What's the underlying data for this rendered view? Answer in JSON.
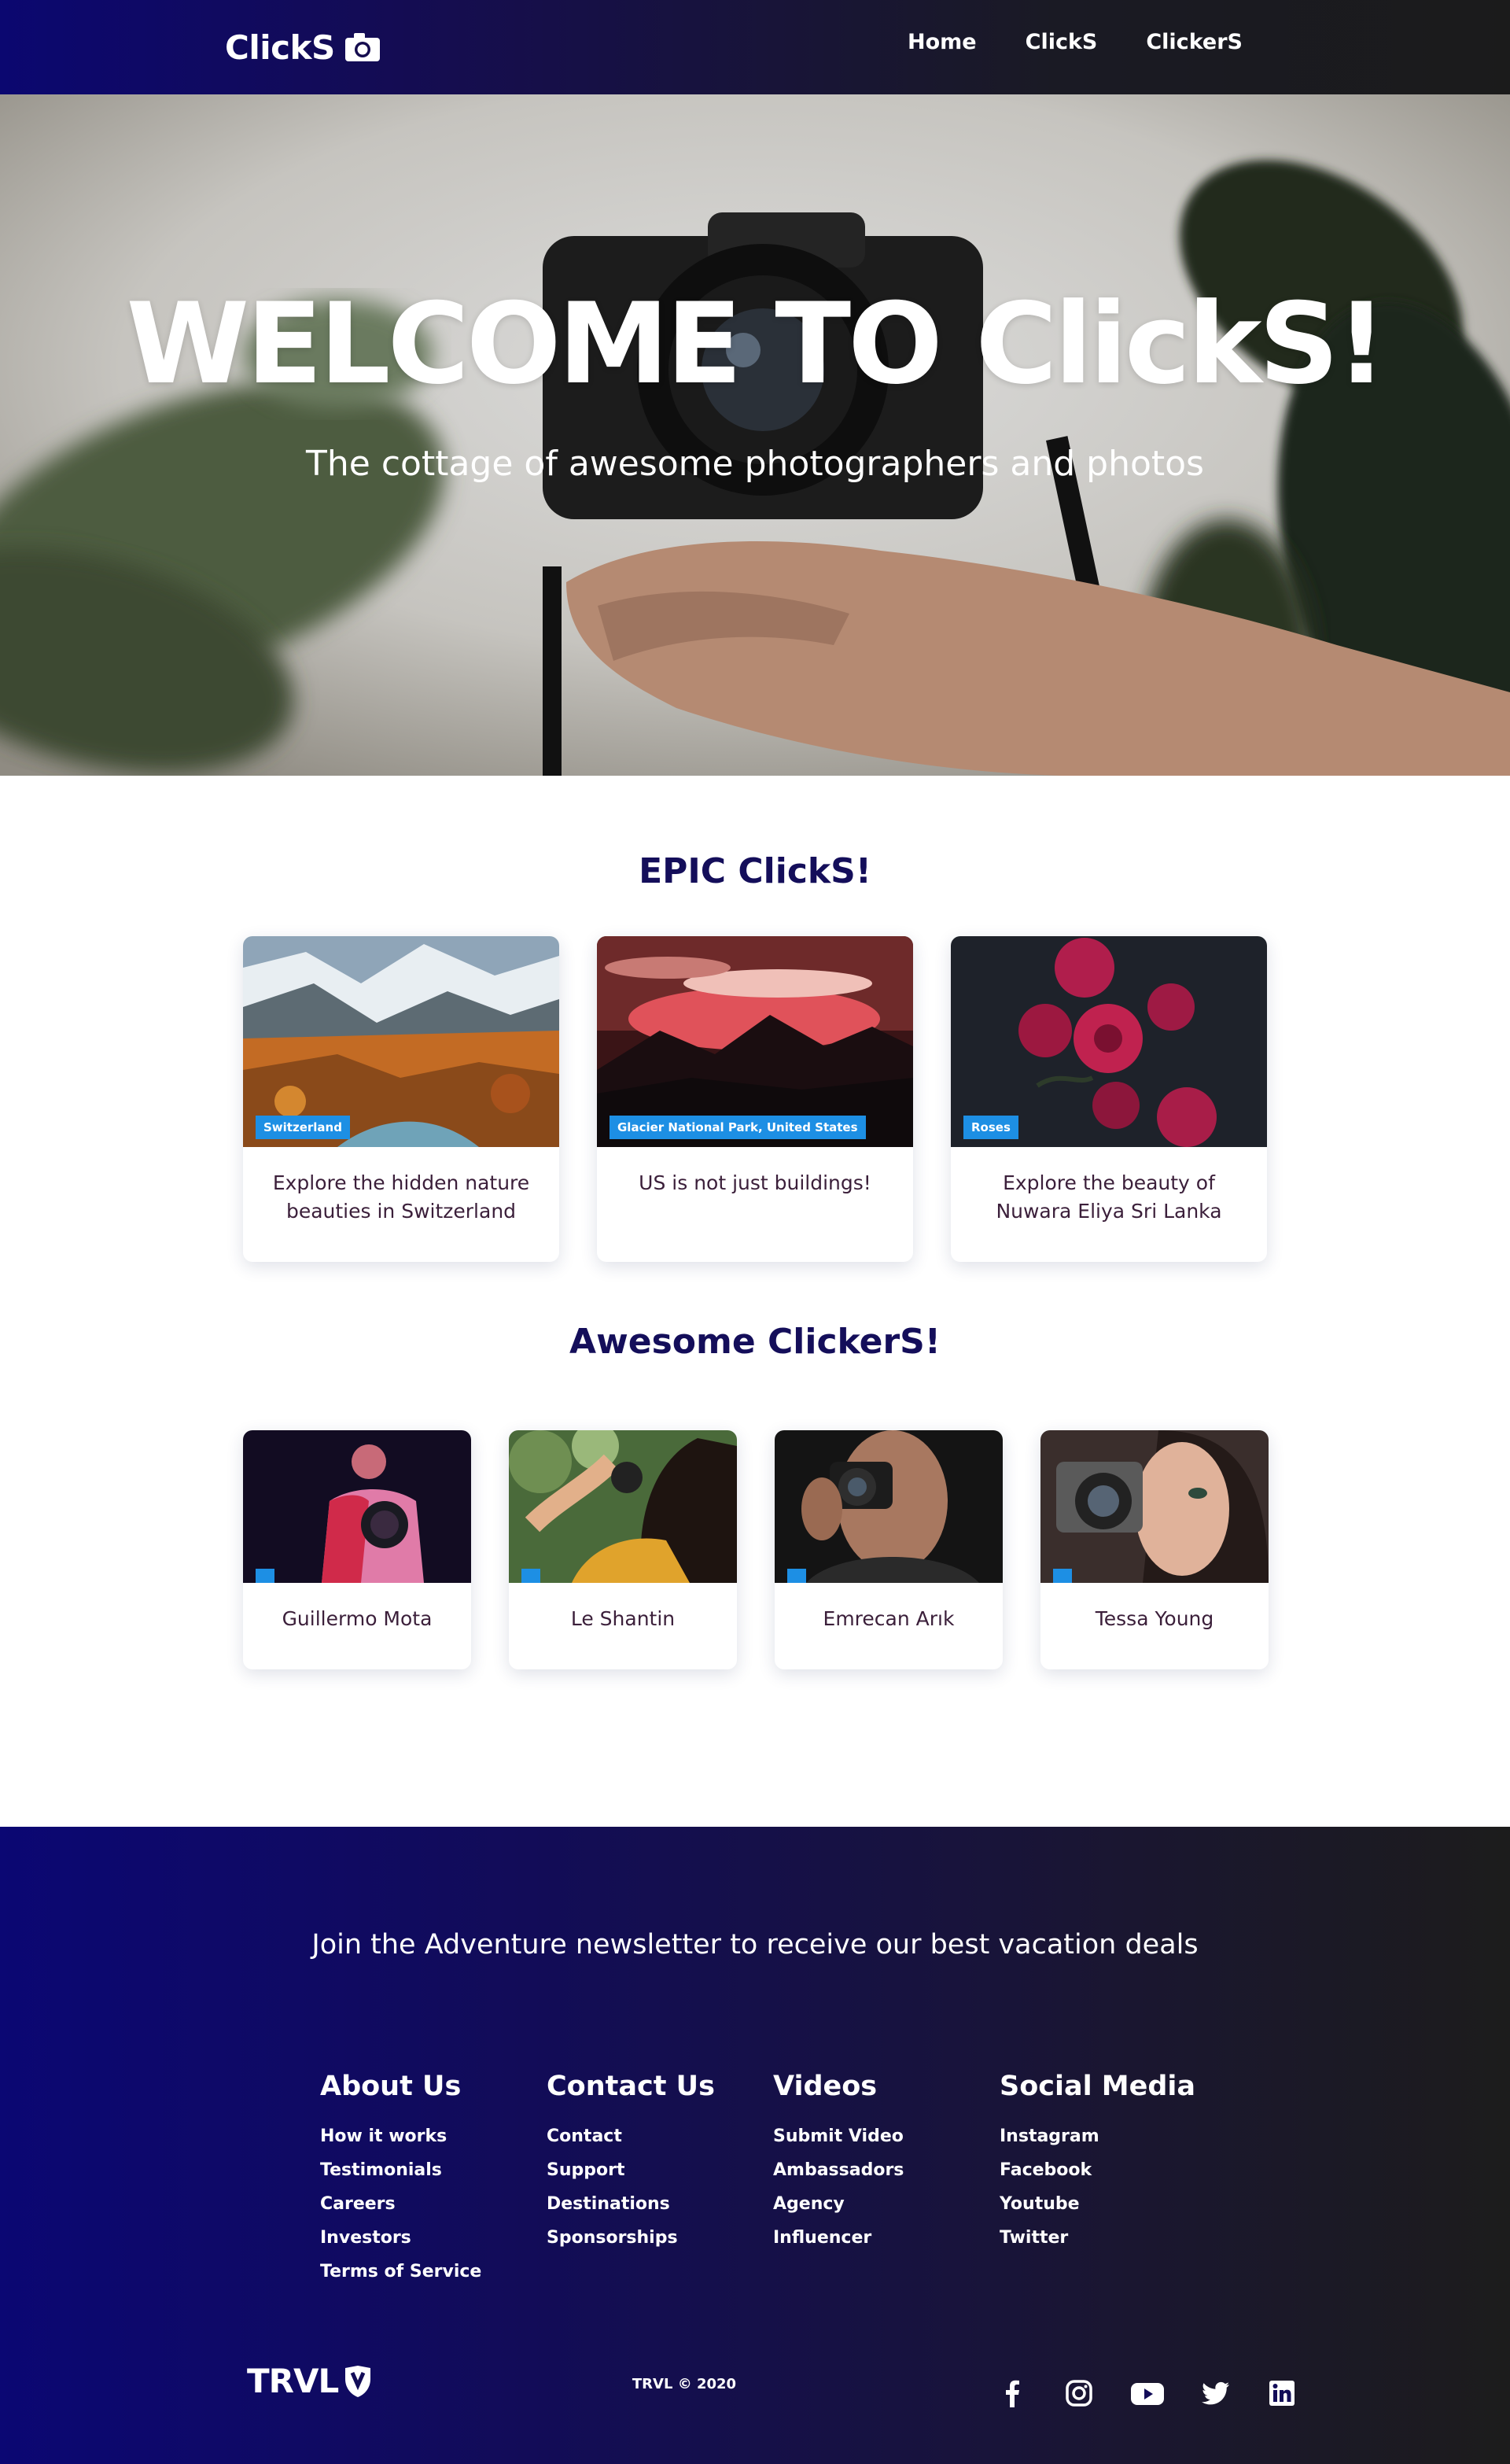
{
  "nav": {
    "logo": "ClickS",
    "links": [
      "Home",
      "ClickS",
      "ClickerS"
    ]
  },
  "hero": {
    "title": "WELCOME TO ClickS!",
    "subtitle": "The cottage of awesome photographers and photos"
  },
  "epic": {
    "title": "EPIC ClickS!",
    "cards": [
      {
        "badge": "Switzerland",
        "text": "Explore the hidden nature beauties in Switzerland"
      },
      {
        "badge": "Glacier National Park, United States",
        "text": "US is not just buildings!"
      },
      {
        "badge": "Roses",
        "text": "Explore the beauty of Nuwara Eliya Sri Lanka"
      }
    ]
  },
  "clickers": {
    "title": "Awesome ClickerS!",
    "people": [
      {
        "name": "Guillermo Mota"
      },
      {
        "name": "Le Shantin"
      },
      {
        "name": "Emrecan Arık"
      },
      {
        "name": "Tessa Young"
      }
    ]
  },
  "footer": {
    "newsletter": "Join the Adventure newsletter to receive our best vacation deals",
    "columns": [
      {
        "title": "About Us",
        "links": [
          "How it works",
          "Testimonials",
          "Careers",
          "Investors",
          "Terms of Service"
        ]
      },
      {
        "title": "Contact Us",
        "links": [
          "Contact",
          "Support",
          "Destinations",
          "Sponsorships"
        ]
      },
      {
        "title": "Videos",
        "links": [
          "Submit Video",
          "Ambassadors",
          "Agency",
          "Influencer"
        ]
      },
      {
        "title": "Social Media",
        "links": [
          "Instagram",
          "Facebook",
          "Youtube",
          "Twitter"
        ]
      }
    ],
    "brand": "TRVL",
    "copyright": "TRVL © 2020",
    "social_icons": [
      "facebook-icon",
      "instagram-icon",
      "youtube-icon",
      "twitter-icon",
      "linkedin-icon"
    ]
  },
  "colors": {
    "accent_blue": "#1d8fe4",
    "title_navy": "#140e5a",
    "nav_gradient_start": "#0b0770"
  }
}
